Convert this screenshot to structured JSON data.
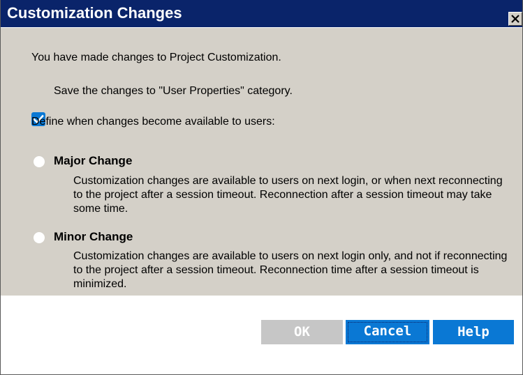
{
  "dialog": {
    "title": "Customization Changes",
    "close_icon": "close-icon"
  },
  "content": {
    "intro": "You have made changes to Project Customization.",
    "save_checkbox": {
      "label": "Save the changes to \"User Properties\" category.",
      "checked": true
    },
    "define_prompt": "Define when changes become available to users:",
    "options": [
      {
        "label": "Major Change",
        "description": "Customization changes are available to users on next login, or when next reconnecting to the project after a session timeout. Reconnection after a session timeout may take some time.",
        "selected": false
      },
      {
        "label": "Minor Change",
        "description": "Customization changes are available to users on next login only, and not if reconnecting to the project after a session timeout. Reconnection time after a session timeout is minimized.",
        "selected": false
      }
    ]
  },
  "footer": {
    "ok_label": "OK",
    "cancel_label": "Cancel",
    "help_label": "Help"
  },
  "colors": {
    "titlebar": "#0a246a",
    "content_bg": "#d4d0c8",
    "accent": "#0a78d4",
    "disabled": "#c6c6c6"
  }
}
